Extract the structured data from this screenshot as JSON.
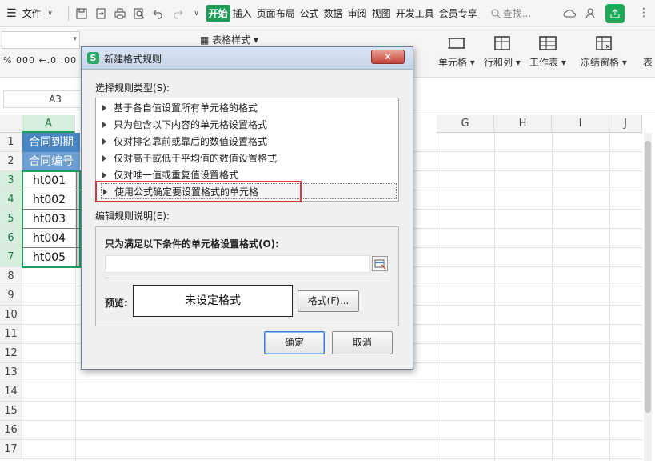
{
  "menubar": {
    "file_label": "文件",
    "tabs": [
      "开始",
      "插入",
      "页面布局",
      "公式",
      "数据",
      "审阅",
      "视图",
      "开发工具",
      "会员专享"
    ],
    "active_tab": "开始",
    "search_placeholder": "查找..."
  },
  "ribbon": {
    "table_style": "表格样式",
    "number_format": "% 000 ←.0 .00",
    "cell": "单元格",
    "row_col": "行和列",
    "worksheet": "工作表",
    "freeze": "冻结窗格",
    "table_more": "表"
  },
  "formula_bar": {
    "name_box": "A3"
  },
  "sheet": {
    "columns": [
      "A",
      "G",
      "H",
      "I",
      "J"
    ],
    "rows": [
      "1",
      "2",
      "3",
      "4",
      "5",
      "6",
      "7",
      "8",
      "9",
      "10",
      "11",
      "12",
      "13",
      "14",
      "15",
      "16",
      "17"
    ],
    "title_cell": "合同到期",
    "header_cell": "合同编号",
    "data": [
      "ht001",
      "ht002",
      "ht003",
      "ht004",
      "ht005"
    ]
  },
  "dialog": {
    "logo": "S",
    "title": "新建格式规则",
    "close_label": "✕",
    "select_type_label": "选择规则类型(S):",
    "rule_types": [
      "基于各自值设置所有单元格的格式",
      "只为包含以下内容的单元格设置格式",
      "仅对排名靠前或靠后的数值设置格式",
      "仅对高于或低于平均值的数值设置格式",
      "仅对唯一值或重复值设置格式",
      "使用公式确定要设置格式的单元格"
    ],
    "edit_desc_label": "编辑规则说明(E):",
    "condition_label": "只为满足以下条件的单元格设置格式(O):",
    "formula_value": "",
    "preview_label": "预览:",
    "preview_text": "未设定格式",
    "format_button": "格式(F)...",
    "ok_button": "确定",
    "cancel_button": "取消"
  },
  "colors": {
    "accent_green": "#1f9b5a",
    "highlight_red": "#d9363e",
    "title_blue": "#4a86c5"
  }
}
